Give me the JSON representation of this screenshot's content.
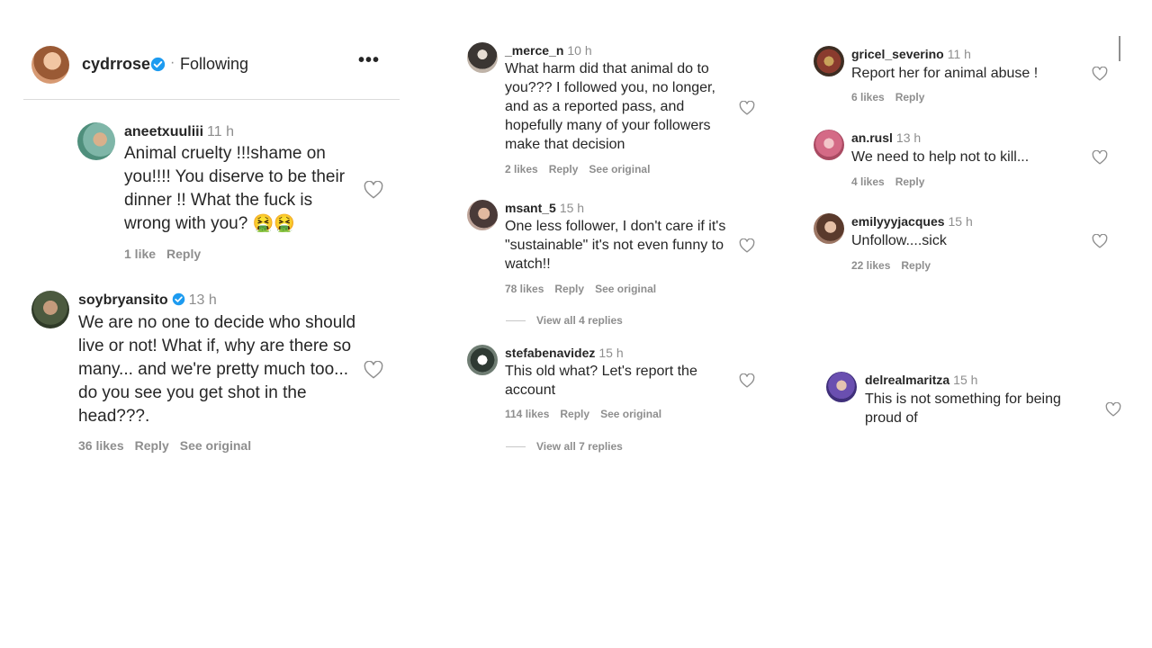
{
  "post": {
    "username": "cydrrose",
    "separator": "·",
    "follow_status": "Following",
    "more": "•••"
  },
  "icons": {
    "verified": "verified-badge-icon",
    "like": "heart-outline-icon",
    "more": "more-horizontal-icon"
  },
  "colors": {
    "verified": "#1d9bf0",
    "text": "#262626",
    "muted": "#8e8e8e"
  },
  "comments": [
    {
      "username": "aneetxuuliii",
      "time": "11 h",
      "text": "Animal cruelty !!!shame on you!!!! You diserve to be their dinner !! What the fuck is wrong with you? 🤮🤮",
      "likes": "1 like",
      "reply": "Reply"
    },
    {
      "username": "soybryansito",
      "time": "13 h",
      "text": "We are no one to decide who should live or not! What if, why are there so many... and we're pretty much too... do you see you get shot in the head???.",
      "likes": "36 likes",
      "reply": "Reply",
      "see_original": "See original"
    },
    {
      "username": "_merce_n",
      "time": "10 h",
      "text": "What harm did that animal do to you??? I followed you, no longer, and as a reported pass, and hopefully many of your followers make that decision",
      "likes": "2 likes",
      "reply": "Reply",
      "see_original": "See original"
    },
    {
      "username": "msant_5",
      "time": "15 h",
      "text": "One less follower, I don't care if it's \"sustainable\" it's not even funny to watch!!",
      "likes": "78 likes",
      "reply": "Reply",
      "see_original": "See original",
      "view_replies": "View all 4 replies"
    },
    {
      "username": "stefabenavidez",
      "time": "15 h",
      "text": "This old what? Let's report the account",
      "likes": "114 likes",
      "reply": "Reply",
      "see_original": "See original",
      "view_replies": "View all 7 replies"
    },
    {
      "username": "gricel_severino",
      "time": "11 h",
      "text": "Report her for animal abuse !",
      "likes": "6 likes",
      "reply": "Reply"
    },
    {
      "username": "an.rusl",
      "time": "13 h",
      "text": "We need to help not to kill...",
      "likes": "4 likes",
      "reply": "Reply"
    },
    {
      "username": "emilyyyjacques",
      "time": "15 h",
      "text": "Unfollow....sick",
      "likes": "22 likes",
      "reply": "Reply"
    },
    {
      "username": "delrealmaritza",
      "time": "15 h",
      "text": "This is not something for being proud of"
    }
  ]
}
